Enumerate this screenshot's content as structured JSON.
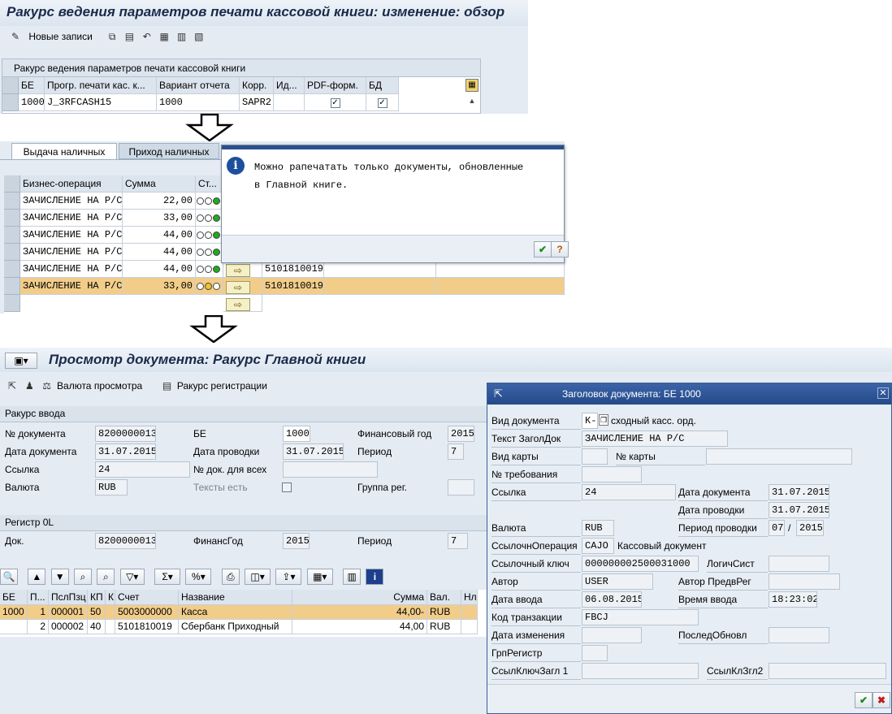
{
  "screen1": {
    "title": "Ракурс ведения параметров печати кассовой книги: изменение: обзор",
    "toolbar": {
      "new_entries": "Новые записи"
    },
    "table_title": "Ракурс ведения параметров печати кассовой книги",
    "columns": [
      "БЕ",
      "Прогр. печати кас. к...",
      "Вариант отчета",
      "Корр.",
      "Ид...",
      "PDF-форм.",
      "БД"
    ],
    "row": {
      "be": "1000",
      "program": "J_3RFCASH15",
      "variant": "1000",
      "corr": "SAPR2",
      "id": "",
      "pdf": "✓",
      "bd": "✓"
    }
  },
  "screen2": {
    "tabs": [
      "Выдача наличных",
      "Приход наличных"
    ],
    "columns": [
      "Бизнес-операция",
      "Сумма",
      "Ст..."
    ],
    "rows": [
      {
        "op": "ЗАЧИСЛЕНИЕ НА Р/С",
        "sum": "22,00",
        "account": ""
      },
      {
        "op": "ЗАЧИСЛЕНИЕ НА Р/С",
        "sum": "33,00",
        "account": ""
      },
      {
        "op": "ЗАЧИСЛЕНИЕ НА Р/С",
        "sum": "44,00",
        "account": ""
      },
      {
        "op": "ЗАЧИСЛЕНИЕ НА Р/С",
        "sum": "44,00",
        "account": ""
      },
      {
        "op": "ЗАЧИСЛЕНИЕ НА Р/С",
        "sum": "44,00",
        "account": "5101810019"
      },
      {
        "op": "ЗАЧИСЛЕНИЕ НА Р/С",
        "sum": "33,00",
        "account": "5101810019"
      }
    ],
    "popup_text": "Можно рапечатать только документы, обновленные в Главной книге."
  },
  "screen3": {
    "title": "Просмотр документа: Ракурс Главной книги",
    "toolbar": {
      "currency": "Валюта просмотра",
      "reg_view": "Ракурс регистрации"
    },
    "entry_view": {
      "header": "Ракурс ввода",
      "doc_no_label": "№ документа",
      "doc_no": "8200000013",
      "be_label": "БЕ",
      "be": "1000",
      "fy_label": "Финансовый год",
      "fy": "2015",
      "doc_date_label": "Дата документа",
      "doc_date": "31.07.2015",
      "post_date_label": "Дата проводки",
      "post_date": "31.07.2015",
      "period_label": "Период",
      "period": "7",
      "ref_label": "Ссылка",
      "ref": "24",
      "docall_label": "№ док. для всех",
      "docall": "",
      "cur_label": "Валюта",
      "cur": "RUB",
      "texts_label": "Тексты есть",
      "grp_label": "Группа рег."
    },
    "ledger": {
      "header": "Регистр 0L",
      "doc_label": "Док.",
      "doc": "8200000013",
      "fy_label": "ФинансГод",
      "fy": "2015",
      "period_label": "Период",
      "period": "7"
    },
    "items_columns": [
      "БЕ",
      "П...",
      "ПслПзц",
      "КП",
      "К",
      "Счет",
      "Название",
      "Сумма",
      "Вал.",
      "Нл"
    ],
    "items": [
      {
        "be": "1000",
        "p": "1",
        "pos": "000001",
        "kp": "50",
        "k": "",
        "acct": "5003000000",
        "name": "Касса",
        "sum": "44,00-",
        "cur": "RUB"
      },
      {
        "be": "",
        "p": "2",
        "pos": "000002",
        "kp": "40",
        "k": "",
        "acct": "5101810019",
        "name": "Сбербанк Приходный",
        "sum": "44,00",
        "cur": "RUB"
      }
    ]
  },
  "dialog": {
    "title": "Заголовок документа: БЕ 1000",
    "doc_type_label": "Вид документа",
    "doc_type": "К-",
    "doc_type_text": "сходный касс. орд.",
    "header_text_label": "Текст ЗаголДок",
    "header_text": "ЗАЧИСЛЕНИЕ НА Р/С",
    "card_type_label": "Вид карты",
    "card_no_label": "№ карты",
    "request_label": "№ требования",
    "ref_label": "Ссылка",
    "ref": "24",
    "doc_date_label": "Дата документа",
    "doc_date": "31.07.2015",
    "post_date_label": "Дата проводки",
    "post_date": "31.07.2015",
    "cur_label": "Валюта",
    "cur": "RUB",
    "period_label": "Период проводки",
    "period_month": "07",
    "period_sep": "/",
    "period_year": "2015",
    "ref_op_label": "СсылочнОперация",
    "ref_op": "CAJO",
    "ref_op_text": "Кассовый документ",
    "ref_key_label": "Ссылочный ключ",
    "ref_key": "000000002500031000",
    "log_sys_label": "ЛогичСист",
    "author_label": "Автор",
    "author": "USER",
    "pre_author_label": "Автор ПредвРег",
    "entry_date_label": "Дата ввода",
    "entry_date": "06.08.2015",
    "entry_time_label": "Время ввода",
    "entry_time": "18:23:02",
    "tcode_label": "Код транзакции",
    "tcode": "FBCJ",
    "change_date_label": "Дата изменения",
    "last_upd_label": "ПоследОбновл",
    "grp_label": "ГрпРегистр",
    "refkey1_label": "СсылКлючЗагл 1",
    "refkey2_label": "СсылКлЗгл2"
  },
  "colors": {
    "highlight": "#f2cd8a",
    "dialog_header": "#2a4f8f",
    "light_green": "#1faa1f"
  }
}
